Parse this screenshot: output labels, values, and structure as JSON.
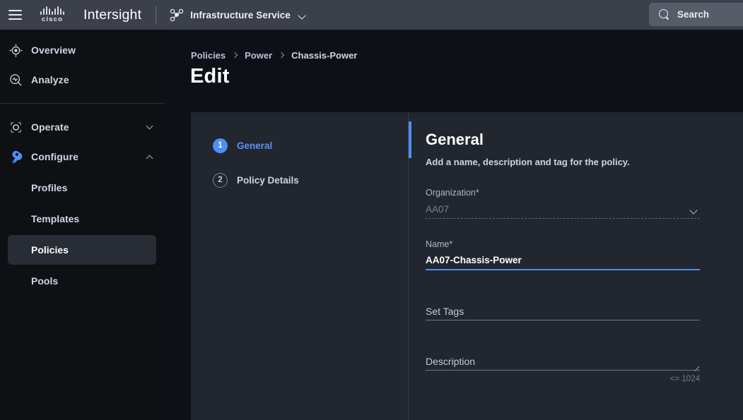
{
  "topbar": {
    "menu_icon": "hamburger-icon",
    "logo_word": "cisco",
    "brand": "Intersight",
    "service_icon": "node-graph-icon",
    "service_label": "Infrastructure Service",
    "service_caret": "chevron-down-icon",
    "search_icon": "search-icon",
    "search_label": "Search"
  },
  "sidebar": {
    "items": [
      {
        "label": "Overview",
        "icon": "target-crosshair-icon",
        "state": "normal"
      },
      {
        "label": "Analyze",
        "icon": "magnifier-pulse-icon",
        "state": "normal"
      }
    ],
    "groups": [
      {
        "label": "Operate",
        "icon": "gear-frame-icon",
        "caret": "chevron-down-icon",
        "expanded": false,
        "children": []
      },
      {
        "label": "Configure",
        "icon": "wrench-icon",
        "caret": "chevron-up-icon",
        "expanded": true,
        "children": [
          {
            "label": "Profiles",
            "active": false
          },
          {
            "label": "Templates",
            "active": false
          },
          {
            "label": "Policies",
            "active": true
          },
          {
            "label": "Pools",
            "active": false
          }
        ]
      }
    ]
  },
  "main": {
    "breadcrumb": [
      "Policies",
      "Power",
      "Chassis-Power"
    ],
    "page_title": "Edit"
  },
  "wizard": {
    "steps": [
      {
        "number": "1",
        "label": "General",
        "active": true
      },
      {
        "number": "2",
        "label": "Policy Details",
        "active": false
      }
    ]
  },
  "form": {
    "title": "General",
    "subtitle": "Add a name, description and tag for the policy.",
    "organization": {
      "label": "Organization",
      "required": "*",
      "value": "AA07",
      "caret": "chevron-down-icon",
      "disabled": true
    },
    "name": {
      "label": "Name",
      "required": "*",
      "value": "AA07-Chassis-Power",
      "focused": true
    },
    "tags": {
      "placeholder": "Set Tags"
    },
    "description": {
      "placeholder": "Description",
      "helper": "<= 1024"
    }
  },
  "colors": {
    "accent": "#4f8ef7",
    "topbar_bg": "#3b404b",
    "page_bg": "#0d1117",
    "card_bg": "#22262e",
    "sidebar_bg": "#0e1014",
    "sidebar_active_bg": "#282c35"
  }
}
